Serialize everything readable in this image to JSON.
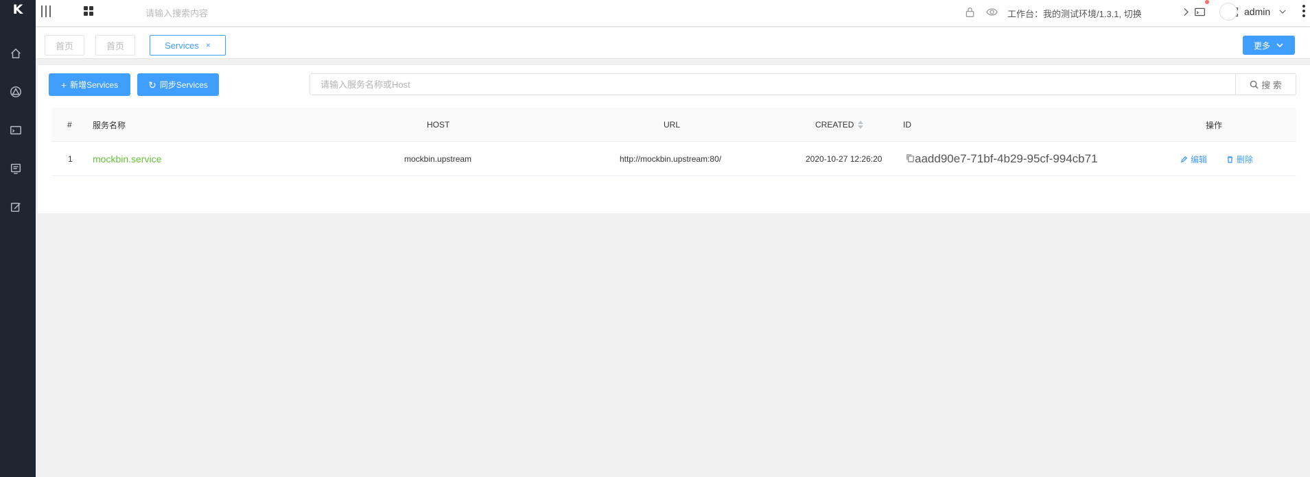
{
  "app": {
    "logo": "K"
  },
  "sidebar": {
    "items": [
      {
        "icon": "home-icon"
      },
      {
        "icon": "triangle-icon"
      },
      {
        "icon": "terminal-icon"
      },
      {
        "icon": "monitor-icon"
      },
      {
        "icon": "edit-icon"
      }
    ]
  },
  "header": {
    "search_placeholder": "请输入搜索内容",
    "workspace_text": "工作台：我的测试环境/1.3.1, 切换",
    "user_name": "admin"
  },
  "tabs": [
    {
      "label": "首页"
    },
    {
      "label": "首页"
    },
    {
      "label": "Services",
      "close": "×",
      "active": true
    }
  ],
  "more_label": "更多",
  "toolbar": {
    "add_label": "新增Services",
    "sync_label": "同步Services",
    "search_placeholder": "请输入服务名称或Host",
    "search_label": "搜 索"
  },
  "table": {
    "headers": {
      "index": "#",
      "name": "服务名称",
      "host": "HOST",
      "url": "URL",
      "created": "CREATED",
      "id": "ID",
      "ops": "操作"
    },
    "rows": [
      {
        "index": "1",
        "name": "mockbin.service",
        "host": "mockbin.upstream",
        "url": "http://mockbin.upstream:80/",
        "created": "2020-10-27 12:26:20",
        "id": "aadd90e7-71bf-4b29-95cf-994cb71",
        "edit_label": "编辑",
        "delete_label": "删除"
      }
    ]
  },
  "colors": {
    "sidebar_bg": "#1f2632",
    "primary": "#409eff",
    "link_green": "#67c23a"
  }
}
